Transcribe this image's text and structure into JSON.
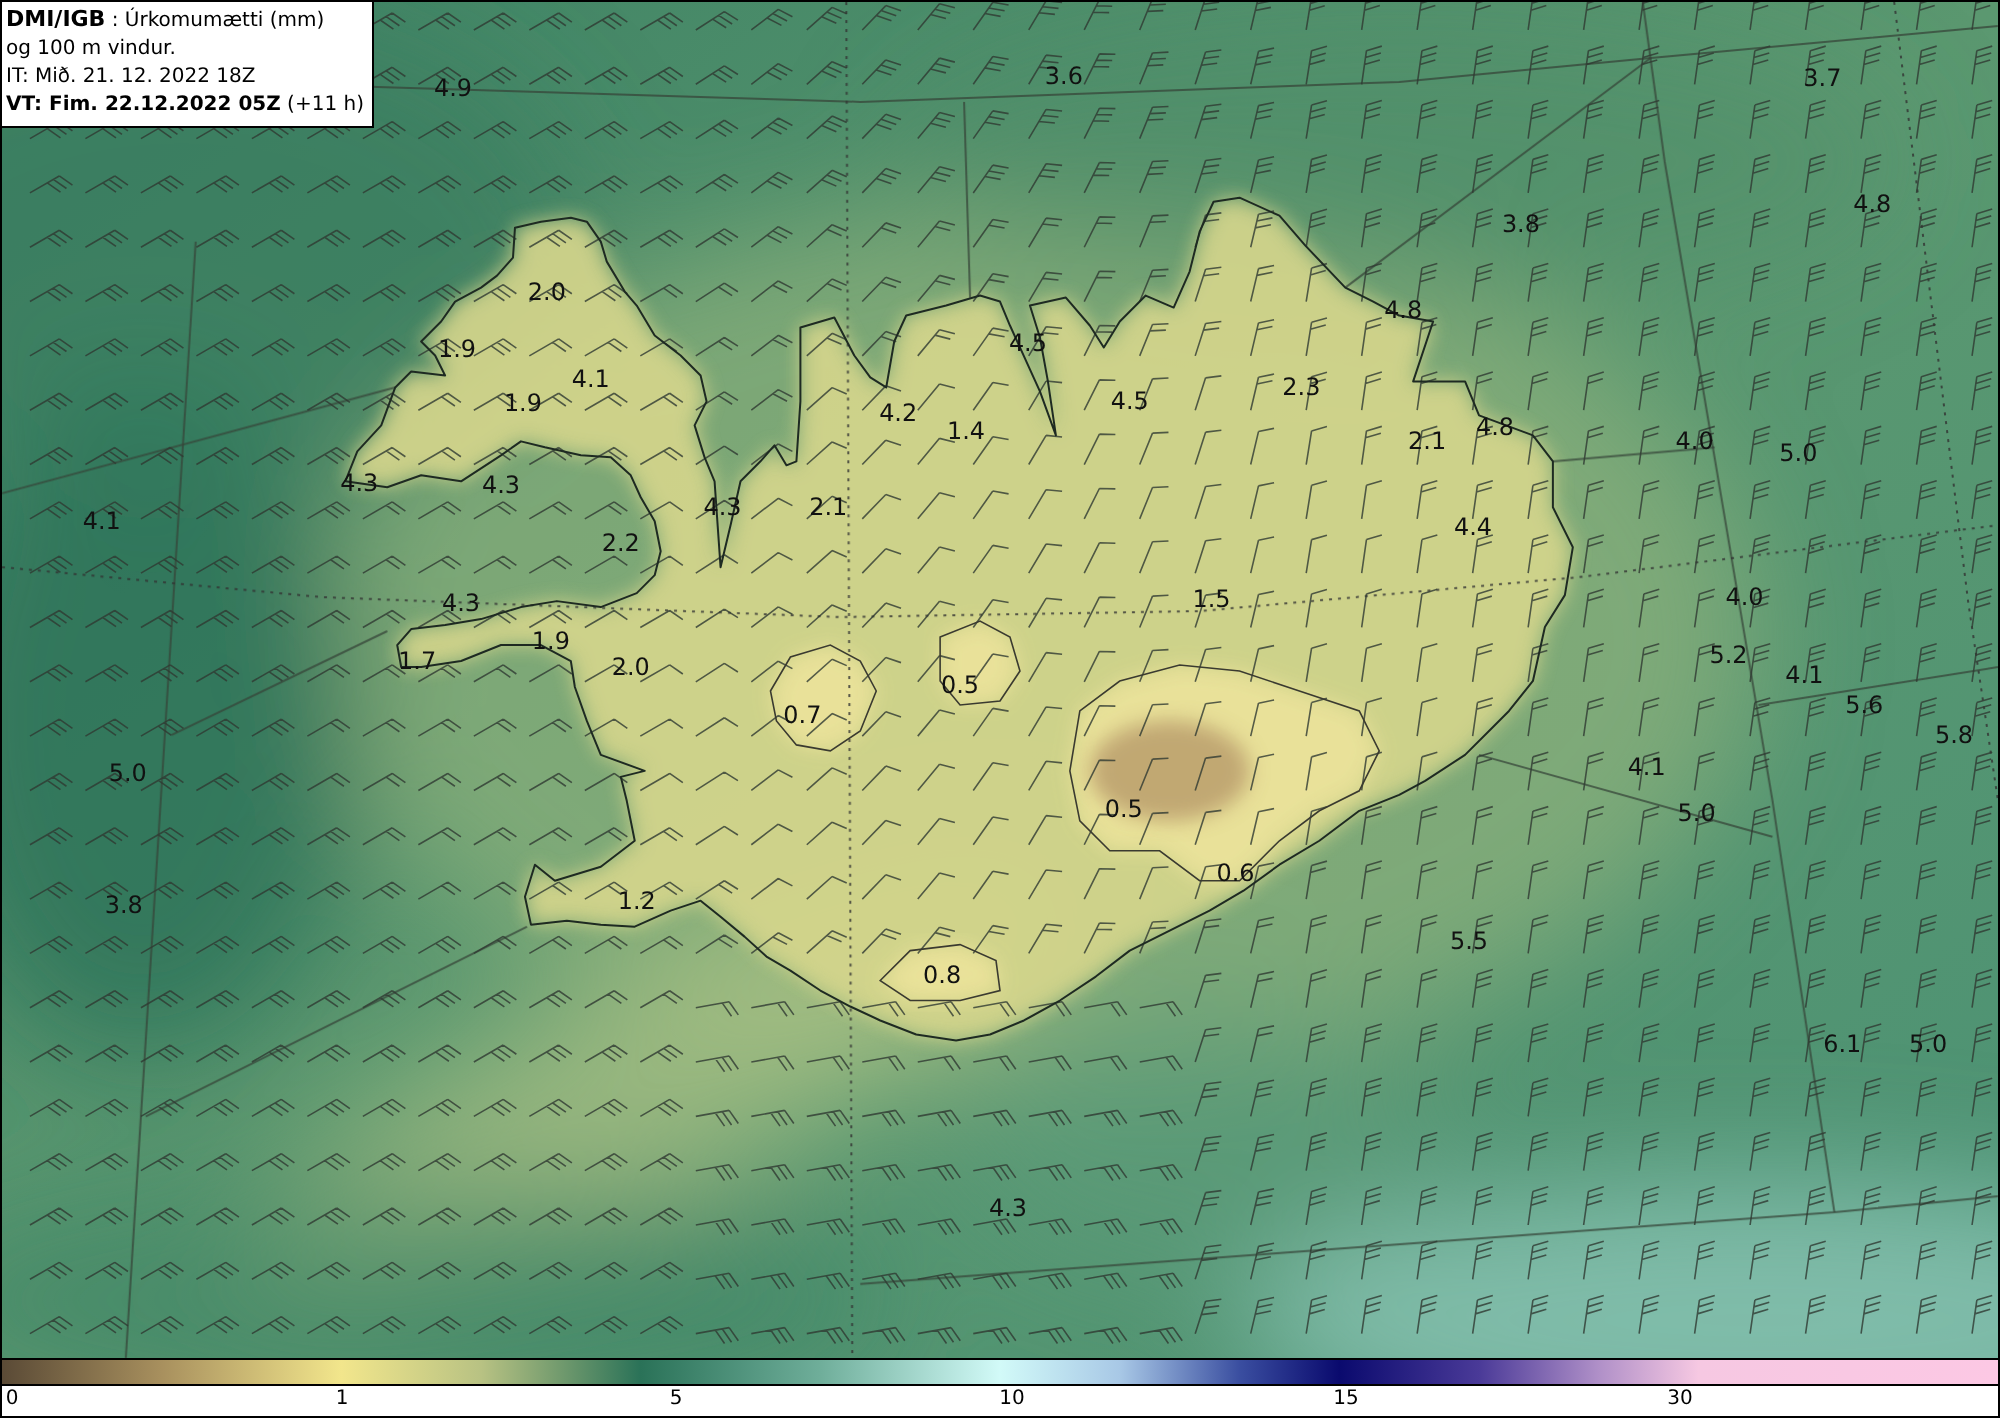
{
  "info_box": {
    "title": "**DMI/IGB** : Úrkomumætti (mm)",
    "subtitle": "og 100 m vindur.",
    "analysis_time": "IT: Mið. 21. 12. 2022 18Z",
    "valid_time": "**VT: Fim. 22.12.2022 05Z** (+11 h)"
  },
  "map": {
    "precipitation_labels": [
      "4.9",
      "3.6",
      "3.7",
      "4.8",
      "3.8",
      "2.0",
      "4.8",
      "1.9",
      "4.5",
      "4.1",
      "2.3",
      "1.9",
      "4.2",
      "4.5",
      "1.4",
      "2.1",
      "4.8",
      "4.0",
      "5.0",
      "4.3",
      "4.3",
      "4.1",
      "2.2",
      "4.3",
      "2.1",
      "4.4",
      "4.3",
      "1.5",
      "4.0",
      "1.9",
      "1.7",
      "2.0",
      "0.5",
      "5.2",
      "4.1",
      "0.7",
      "5.6",
      "5.8",
      "5.0",
      "4.1",
      "0.5",
      "5.0",
      "0.6",
      "3.8",
      "1.2",
      "5.5",
      "0.8",
      "6.1",
      "5.0",
      "4.3"
    ]
  },
  "color_scale": {
    "tick_labels": [
      "0",
      "1",
      "5",
      "10",
      "15",
      "30"
    ]
  }
}
